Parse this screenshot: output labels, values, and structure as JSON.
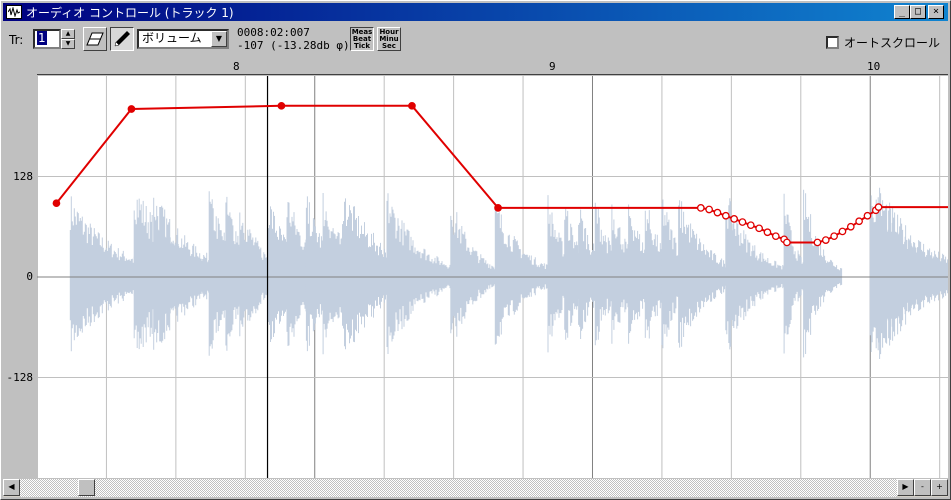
{
  "window": {
    "title": "オーディオ コントロール (トラック 1)"
  },
  "toolbar": {
    "track_label": "Tr:",
    "track_value": "1",
    "parameter": "ボリューム",
    "position_time": "0008:02:007",
    "position_value": "-107 (-13.28db φ)",
    "meas_button": "Meas Beat Tick",
    "hour_button": "Hour Minu Sec",
    "autoscroll_label": "オートスクロール",
    "autoscroll_checked": false
  },
  "icons": {
    "app": "waveform-app-icon",
    "eraser": "eraser-icon",
    "pencil": "pencil-icon"
  },
  "colors": {
    "waveform": "#c3cfdf",
    "envelope": "#e00000",
    "grid": "#c0c0c0",
    "measure_line": "#808080"
  },
  "ruler": {
    "measures": [
      "8",
      "9",
      "10"
    ]
  },
  "yaxis": {
    "labels": [
      "128",
      "0",
      "-128"
    ]
  },
  "chart_data": {
    "type": "line",
    "x_unit": "measure",
    "ylim": [
      -256,
      256
    ],
    "xlim": [
      7.0,
      10.28
    ],
    "envelope": [
      [
        7.07,
        94
      ],
      [
        7.34,
        214
      ],
      [
        7.88,
        218
      ],
      [
        8.35,
        218
      ],
      [
        8.66,
        88
      ],
      [
        9.39,
        88
      ],
      [
        9.42,
        86
      ],
      [
        9.45,
        82
      ],
      [
        9.48,
        78
      ],
      [
        9.51,
        74
      ],
      [
        9.54,
        70
      ],
      [
        9.57,
        66
      ],
      [
        9.6,
        62
      ],
      [
        9.63,
        57
      ],
      [
        9.66,
        52
      ],
      [
        9.69,
        48
      ],
      [
        9.7,
        44
      ],
      [
        9.81,
        44
      ],
      [
        9.84,
        47
      ],
      [
        9.87,
        52
      ],
      [
        9.9,
        58
      ],
      [
        9.93,
        64
      ],
      [
        9.96,
        71
      ],
      [
        9.99,
        78
      ],
      [
        10.02,
        85
      ],
      [
        10.03,
        89
      ],
      [
        10.28,
        89
      ]
    ],
    "hits": [
      [
        7.12,
        0.85,
        16
      ],
      [
        7.35,
        1.0,
        14
      ],
      [
        7.42,
        0.9,
        14
      ],
      [
        7.62,
        0.9,
        8
      ],
      [
        7.68,
        0.85,
        8
      ],
      [
        7.73,
        0.8,
        8
      ],
      [
        7.83,
        0.9,
        8
      ],
      [
        7.9,
        0.9,
        8
      ],
      [
        7.97,
        0.85,
        8
      ],
      [
        8.03,
        0.9,
        8
      ],
      [
        8.1,
        0.95,
        14
      ],
      [
        8.26,
        0.9,
        12
      ],
      [
        8.49,
        0.85,
        8
      ],
      [
        8.65,
        0.8,
        10
      ],
      [
        8.84,
        0.85,
        6
      ],
      [
        8.9,
        0.8,
        6
      ],
      [
        8.95,
        0.8,
        6
      ],
      [
        9.01,
        0.85,
        6
      ],
      [
        9.07,
        0.85,
        6
      ],
      [
        9.13,
        0.85,
        6
      ],
      [
        9.19,
        0.85,
        6
      ],
      [
        9.25,
        0.9,
        6
      ],
      [
        9.31,
        0.85,
        10
      ],
      [
        9.48,
        0.9,
        10
      ],
      [
        9.69,
        0.9,
        4
      ],
      [
        9.76,
        0.95,
        6
      ],
      [
        10.0,
        1.0,
        14
      ],
      [
        10.03,
        0.95,
        16
      ]
    ]
  }
}
